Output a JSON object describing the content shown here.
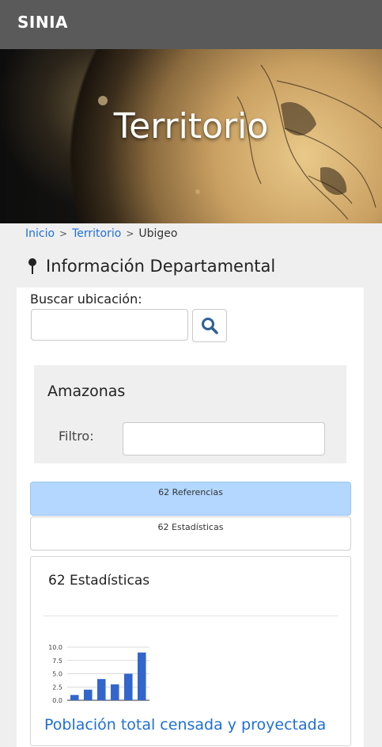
{
  "header": {
    "brand": "SINIA"
  },
  "hero": {
    "title": "Territorio"
  },
  "breadcrumb": {
    "items": [
      "Inicio",
      "Territorio"
    ],
    "current": "Ubigeo",
    "separator": ">"
  },
  "section": {
    "title": "Información Departamental",
    "icon": "map-pin-icon"
  },
  "search": {
    "label": "Buscar ubicación:",
    "value": "",
    "button_icon": "search-icon"
  },
  "department": {
    "name": "Amazonas",
    "filter_label": "Filtro:",
    "filter_value": ""
  },
  "tabs": [
    {
      "label": "62 Referencias",
      "active": true
    },
    {
      "label": "62 Estadísticas",
      "active": false
    }
  ],
  "card": {
    "title": "62 Estadísticas"
  },
  "colors": {
    "link": "#1f6fd6",
    "topbar": "#5a5a5a",
    "active_tab": "#b3d7ff",
    "bar": "#3366cc"
  },
  "chart_data": {
    "type": "bar",
    "title": "Población total censada y proyectada",
    "categories": [
      "",
      "",
      "",
      "",
      "",
      ""
    ],
    "values": [
      1.0,
      2.0,
      4.0,
      3.0,
      5.0,
      9.0
    ],
    "ylim": [
      0,
      10
    ],
    "yticks": [
      "10.0",
      "7.5",
      "5.0",
      "2.5",
      "0.0"
    ],
    "grid": true
  }
}
